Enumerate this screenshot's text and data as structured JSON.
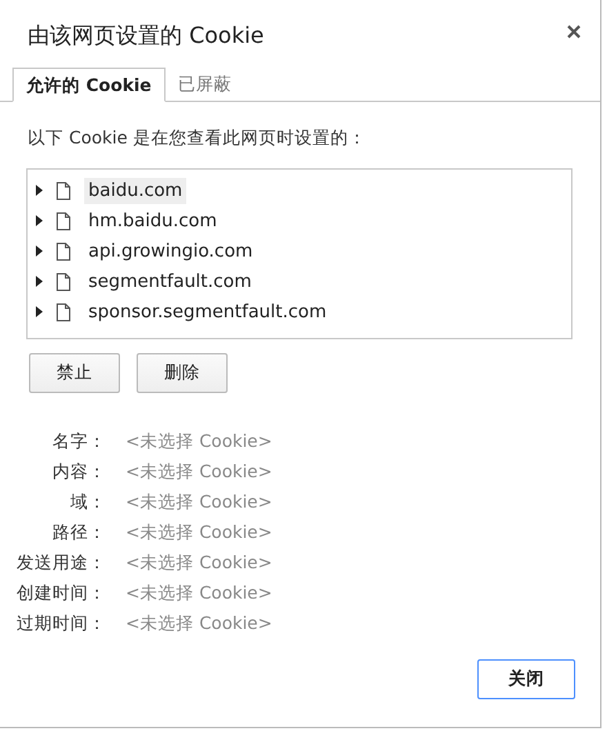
{
  "window": {
    "title": "由该网页设置的 Cookie"
  },
  "tabs": [
    {
      "label": "允许的 Cookie",
      "selected": true
    },
    {
      "label": "已屏蔽",
      "selected": false
    }
  ],
  "intro": "以下 Cookie 是在您查看此网页时设置的：",
  "tree": [
    {
      "label": "baidu.com",
      "selected": true,
      "expanded": false
    },
    {
      "label": "hm.baidu.com",
      "selected": false,
      "expanded": false
    },
    {
      "label": "api.growingio.com",
      "selected": false,
      "expanded": false
    },
    {
      "label": "segmentfault.com",
      "selected": false,
      "expanded": false
    },
    {
      "label": "sponsor.segmentfault.com",
      "selected": false,
      "expanded": false
    }
  ],
  "actions": [
    "禁止",
    "删除"
  ],
  "details": [
    {
      "label": "名字：",
      "value": "<未选择 Cookie>"
    },
    {
      "label": "内容：",
      "value": "<未选择 Cookie>"
    },
    {
      "label": "域：",
      "value": "<未选择 Cookie>"
    },
    {
      "label": "路径：",
      "value": "<未选择 Cookie>"
    },
    {
      "label": "发送用途：",
      "value": "<未选择 Cookie>"
    },
    {
      "label": "创建时间：",
      "value": "<未选择 Cookie>"
    },
    {
      "label": "过期时间：",
      "value": "<未选择 Cookie>"
    }
  ],
  "close_button": "关闭"
}
